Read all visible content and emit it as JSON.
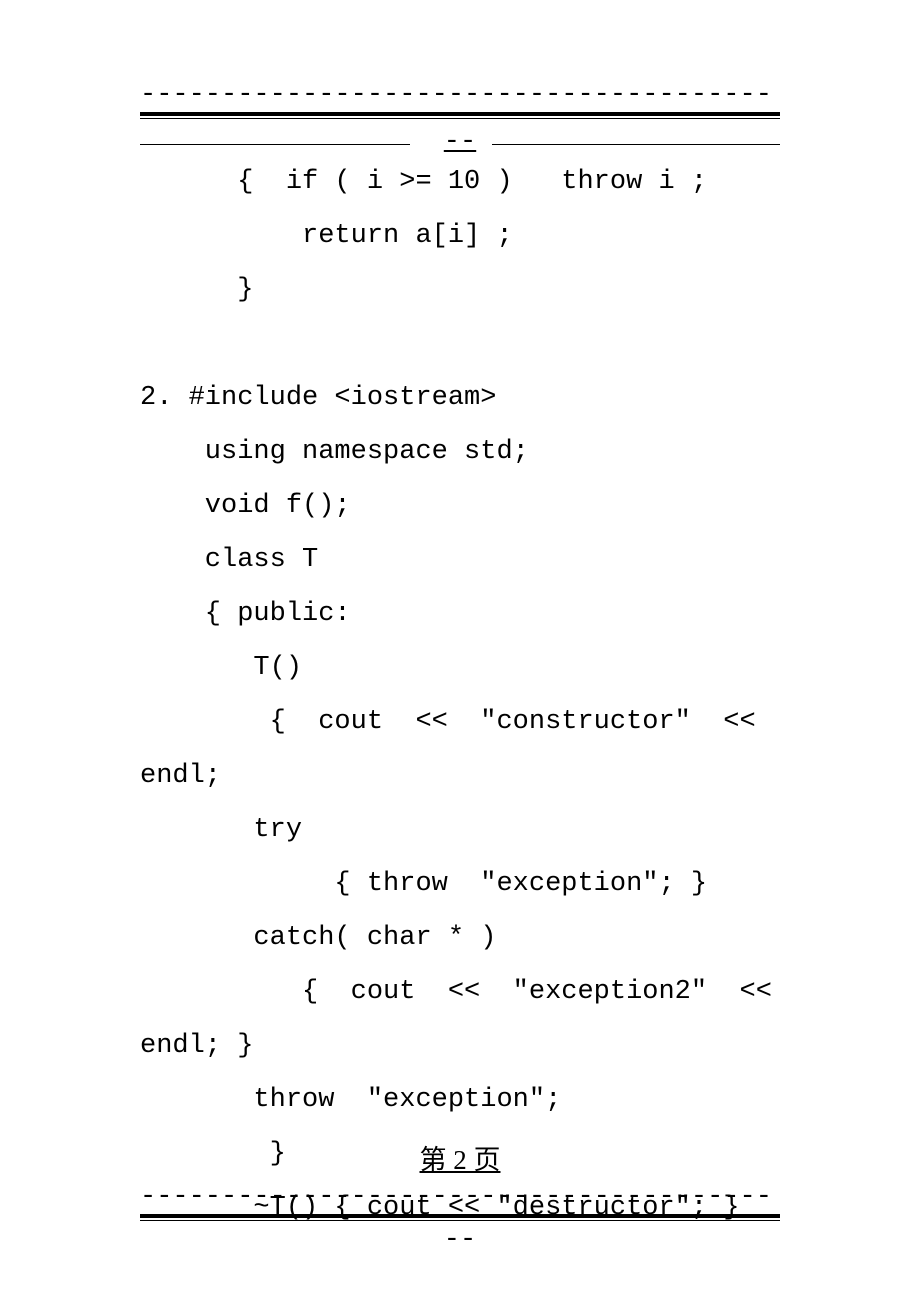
{
  "divider": {
    "dash_line": "---------------------------------------",
    "center_dash": "--"
  },
  "code": {
    "snippet1": {
      "line1": "      {  if ( i >= 10 )   throw i ;",
      "line2": "          return a[i] ;",
      "line3": "      }"
    },
    "section2": {
      "header": "2. #include <iostream>",
      "line1": "    using namespace std;",
      "line2": "    void f();",
      "line3": "    class T",
      "line4": "    { public:",
      "line5": "       T()",
      "line6": "        {  cout  <<  \"constructor\"  <<",
      "line7": "endl;",
      "line8": "       try",
      "line9": "            { throw  \"exception\"; }",
      "line10": "       catch( char * )",
      "line11": "          {  cout  <<  \"exception2\"  <<",
      "line12": "endl; }",
      "line13": "       throw  \"exception\";",
      "line14": "        }",
      "line15": "       ~T() { cout << \"destructor\"; }"
    }
  },
  "footer": {
    "page_label": "第 2 页"
  }
}
